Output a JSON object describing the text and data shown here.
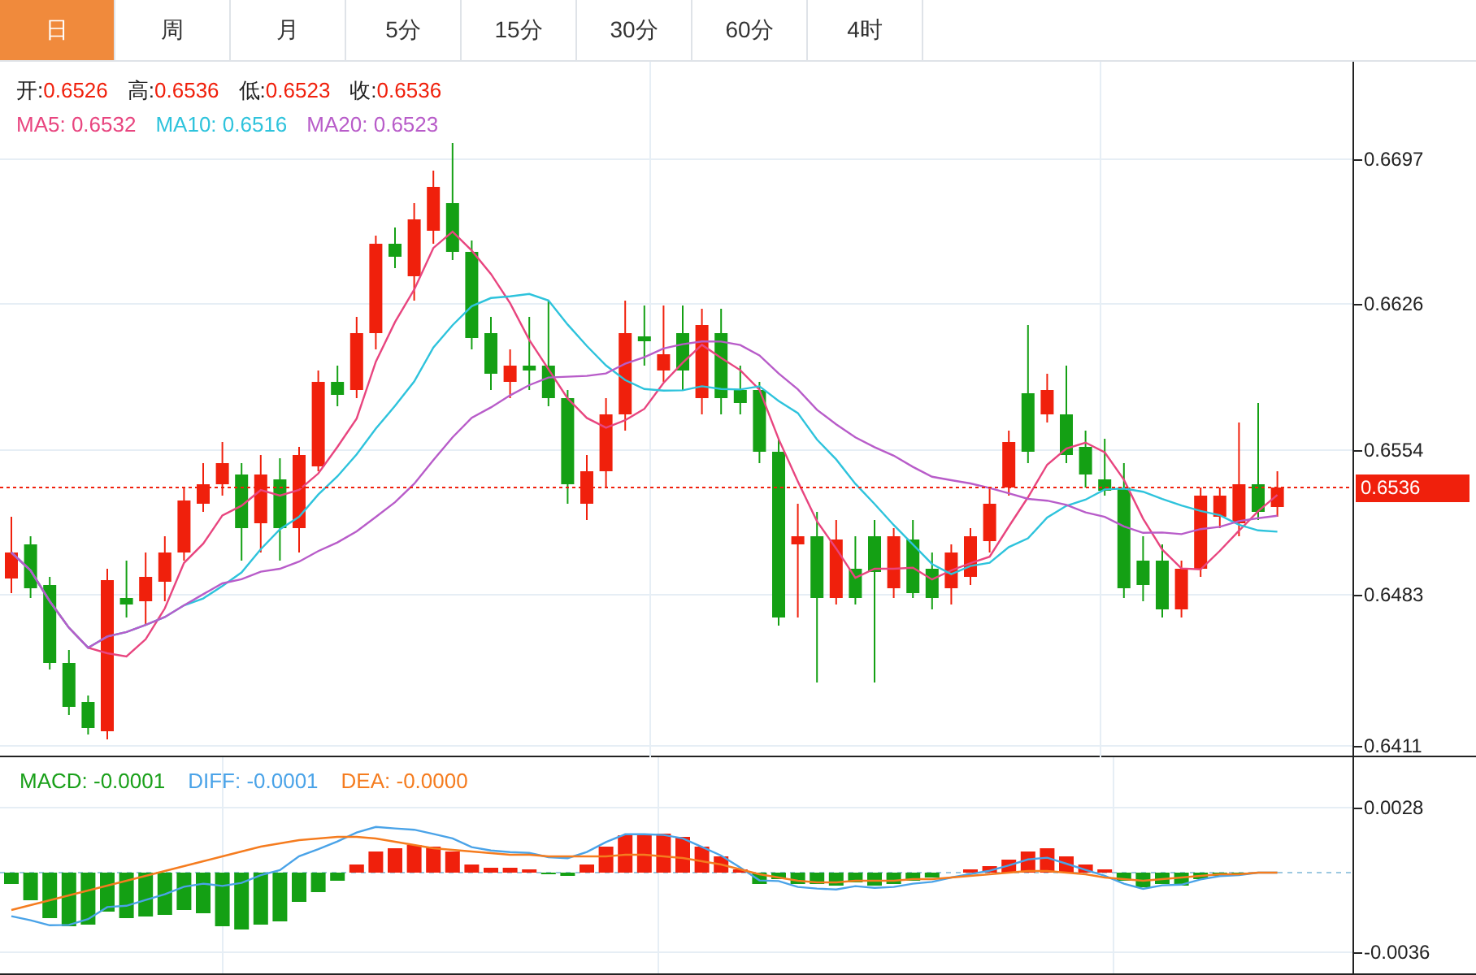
{
  "tabs": [
    {
      "label": "日",
      "selected": true
    },
    {
      "label": "周",
      "selected": false
    },
    {
      "label": "月",
      "selected": false
    },
    {
      "label": "5分",
      "selected": false
    },
    {
      "label": "15分",
      "selected": false
    },
    {
      "label": "30分",
      "selected": false
    },
    {
      "label": "60分",
      "selected": false
    },
    {
      "label": "4时",
      "selected": false
    }
  ],
  "ohlc": [
    {
      "label": "开:",
      "value": "0.6526"
    },
    {
      "label": "高:",
      "value": "0.6536"
    },
    {
      "label": "低:",
      "value": "0.6523"
    },
    {
      "label": "收:",
      "value": "0.6536"
    }
  ],
  "ma_legend": [
    {
      "label": "MA5: 0.6532",
      "color": "#e8457f"
    },
    {
      "label": "MA10: 0.6516",
      "color": "#2ec3dc"
    },
    {
      "label": "MA20: 0.6523",
      "color": "#b85cc9"
    }
  ],
  "price_axis": {
    "ticks": [
      "0.6697",
      "0.6626",
      "0.6554",
      "0.6483",
      "0.6411"
    ],
    "current_price": "0.6536"
  },
  "macd_legend": [
    {
      "label": "MACD: -0.0001",
      "color": "#1aa01a"
    },
    {
      "label": "DIFF: -0.0001",
      "color": "#4aa3e8"
    },
    {
      "label": "DEA: -0.0000",
      "color": "#f57c1f"
    }
  ],
  "macd_axis": {
    "ticks": [
      "0.0028",
      "-0.0036"
    ]
  }
}
